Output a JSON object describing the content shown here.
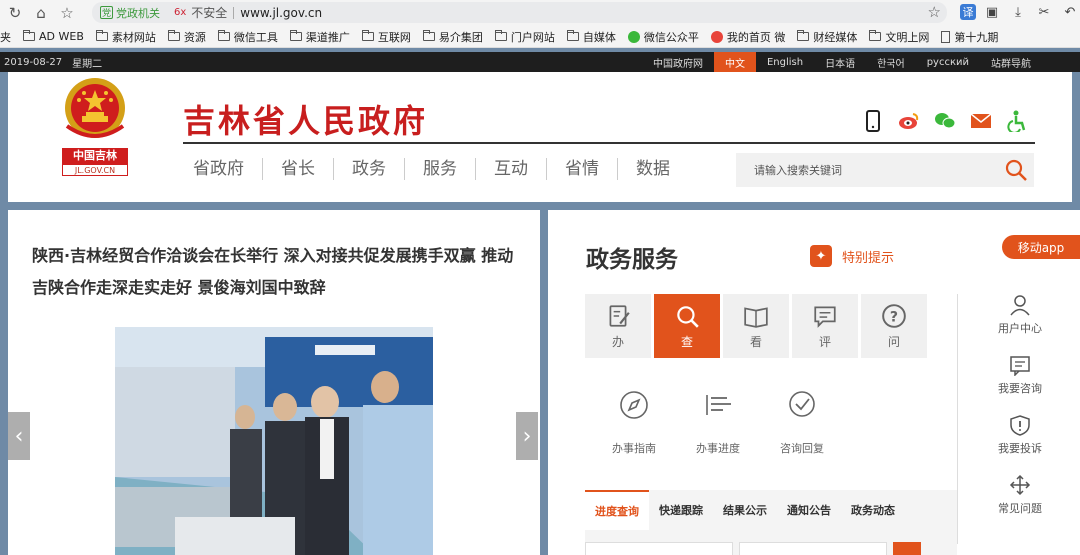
{
  "browser": {
    "address": {
      "badge": "党政机关",
      "insecure_icon": "6x",
      "insecure_label": "不安全",
      "url": "www.jl.gov.cn"
    },
    "bookmarks": [
      {
        "label": "夹",
        "icon": "none"
      },
      {
        "label": "AD WEB",
        "icon": "folder"
      },
      {
        "label": "素材网站",
        "icon": "folder"
      },
      {
        "label": "资源",
        "icon": "folder"
      },
      {
        "label": "微信工具",
        "icon": "folder"
      },
      {
        "label": "渠道推广",
        "icon": "folder"
      },
      {
        "label": "互联网",
        "icon": "folder"
      },
      {
        "label": "易介集团",
        "icon": "folder"
      },
      {
        "label": "门户网站",
        "icon": "folder"
      },
      {
        "label": "自媒体",
        "icon": "folder"
      },
      {
        "label": "微信公众平",
        "icon": "wechat"
      },
      {
        "label": "我的首页 微",
        "icon": "weibo"
      },
      {
        "label": "财经媒体",
        "icon": "folder"
      },
      {
        "label": "文明上网",
        "icon": "folder"
      },
      {
        "label": "第十九期",
        "icon": "page"
      }
    ],
    "right_icons": [
      "translate-icon",
      "extension-icon",
      "download-icon",
      "cut-icon",
      "back-icon"
    ]
  },
  "topbar": {
    "date": "2019-08-27",
    "weekday": "星期二",
    "links": [
      {
        "label": "中国政府网",
        "active": false
      },
      {
        "label": "中文",
        "active": true
      },
      {
        "label": "English",
        "active": false
      },
      {
        "label": "日本语",
        "active": false
      },
      {
        "label": "한국어",
        "active": false
      },
      {
        "label": "русский",
        "active": false
      },
      {
        "label": "站群导航",
        "active": false
      }
    ]
  },
  "header": {
    "emblem_label": "中国吉林",
    "emblem_sub": "JL.GOV.CN",
    "title": "吉林省人民政府",
    "nav": [
      "省政府",
      "省长",
      "政务",
      "服务",
      "互动",
      "省情",
      "数据"
    ],
    "search_placeholder": "请输入搜索关键词",
    "accent": "#c81e1e"
  },
  "news": {
    "title": "陕西·吉林经贸合作洽谈会在长举行 深入对接共促发展携手双赢 推动吉陕合作走深走实走好 景俊海刘国中致辞"
  },
  "services": {
    "title": "政务服务",
    "notice": "特别提示",
    "mobile_app": "移动app",
    "accent": "#e1531c",
    "tiles": [
      {
        "label": "办",
        "icon": "edit-icon",
        "active": false
      },
      {
        "label": "查",
        "icon": "search-icon",
        "active": true
      },
      {
        "label": "看",
        "icon": "book-icon",
        "active": false
      },
      {
        "label": "评",
        "icon": "comment-icon",
        "active": false
      },
      {
        "label": "问",
        "icon": "question-icon",
        "active": false
      }
    ],
    "sub_items": [
      {
        "label": "办事指南",
        "icon": "compass-icon"
      },
      {
        "label": "办事进度",
        "icon": "progress-icon"
      },
      {
        "label": "咨询回复",
        "icon": "check-circle-icon"
      }
    ],
    "tabs": [
      {
        "label": "进度查询",
        "active": true
      },
      {
        "label": "快递跟踪",
        "active": false
      },
      {
        "label": "结果公示",
        "active": false
      },
      {
        "label": "通知公告",
        "active": false
      },
      {
        "label": "政务动态",
        "active": false
      }
    ],
    "side_links": [
      {
        "label": "用户中心",
        "icon": "user-icon"
      },
      {
        "label": "我要咨询",
        "icon": "message-icon"
      },
      {
        "label": "我要投诉",
        "icon": "shield-icon"
      },
      {
        "label": "常见问题",
        "icon": "move-icon"
      }
    ]
  }
}
